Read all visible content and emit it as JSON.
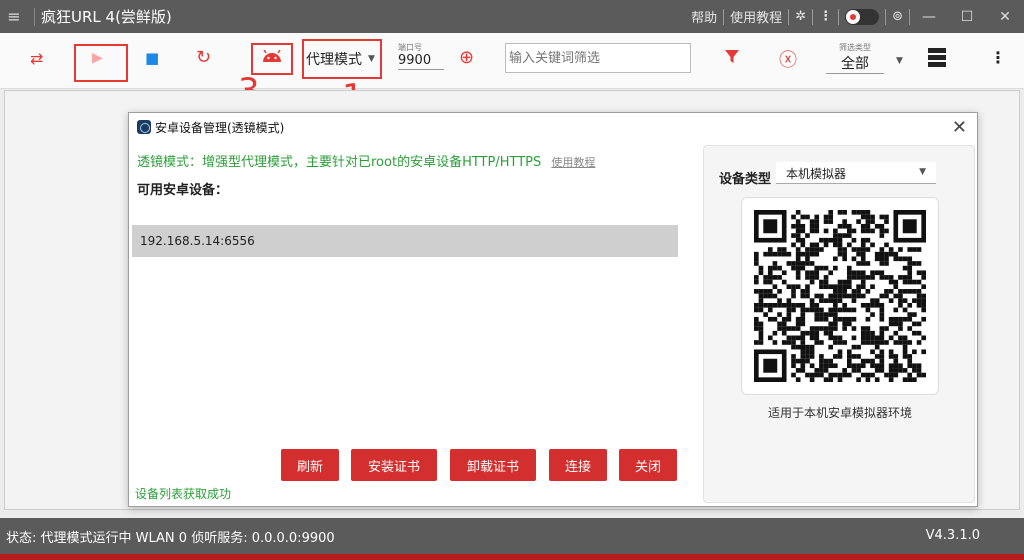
{
  "window": {
    "title": "疯狂URL 4(尝鲜版)",
    "help": "帮助",
    "tutorial": "使用教程"
  },
  "toolbar": {
    "mode": "代理模式",
    "port_label": "端口号",
    "port_value": "9900",
    "filter_placeholder": "输入关键词筛选",
    "filter_type_label": "筛选类型",
    "filter_type_value": "全部"
  },
  "annotations": [
    "1",
    "2",
    "3"
  ],
  "dialog": {
    "title": "安卓设备管理(透镜模式)",
    "hint": "透镜模式：增强型代理模式，主要针对已root的安卓设备HTTP/HTTPS",
    "hint_link": "使用教程",
    "available_label": "可用安卓设备：",
    "devices": [
      "192.168.5.14:6556"
    ],
    "device_type_label": "设备类型",
    "device_type_value": "本机模拟器",
    "qr_caption": "适用于本机安卓模拟器环境",
    "buttons": {
      "refresh": "刷新",
      "install_cert": "安装证书",
      "uninstall_cert": "卸载证书",
      "connect": "连接",
      "close": "关闭"
    },
    "status": "设备列表获取成功"
  },
  "statusbar": {
    "text": "状态:  代理模式运行中  WLAN 0 侦听服务: 0.0.0.0:9900",
    "version": "V4.3.1.0"
  }
}
